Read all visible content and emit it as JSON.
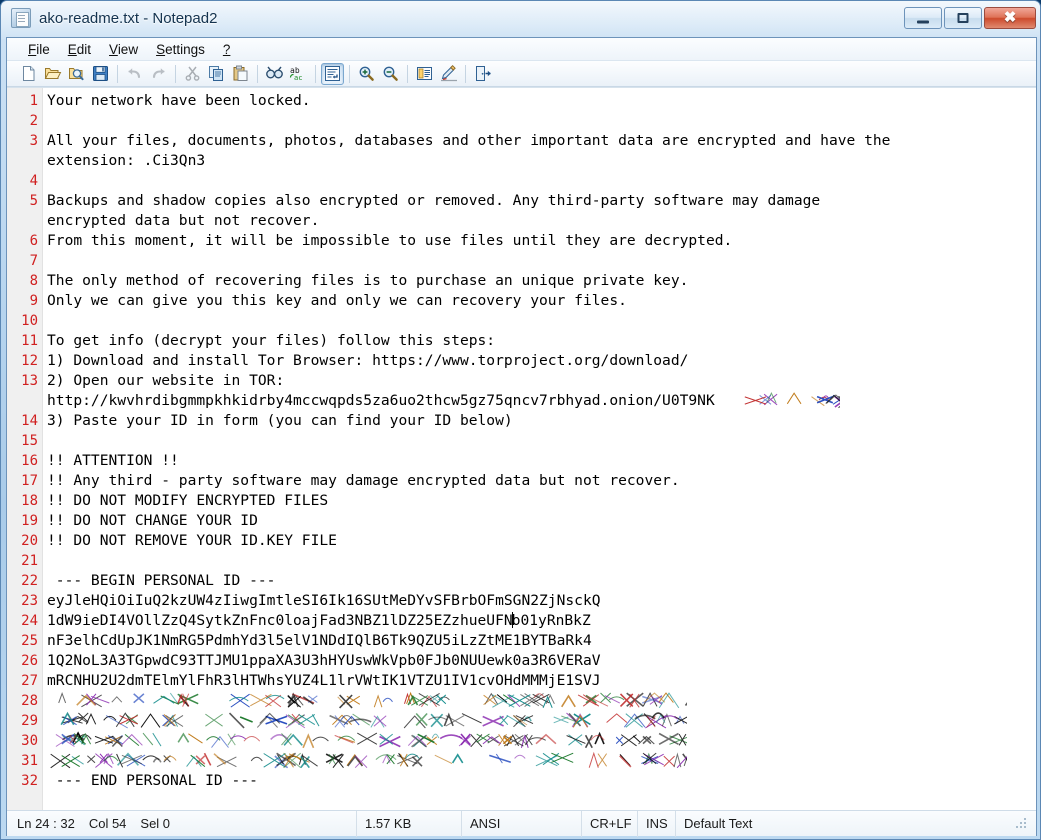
{
  "window": {
    "title": "ako-readme.txt - Notepad2",
    "icon": "notepad-document-icon",
    "buttons": {
      "minimize": "Minimize",
      "maximize": "Maximize",
      "close": "Close"
    }
  },
  "menubar": {
    "items": [
      {
        "label": "File",
        "mnemonic": "F"
      },
      {
        "label": "Edit",
        "mnemonic": "E"
      },
      {
        "label": "View",
        "mnemonic": "V"
      },
      {
        "label": "Settings",
        "mnemonic": "S"
      },
      {
        "label": "?",
        "mnemonic": "?"
      }
    ]
  },
  "toolbar": {
    "buttons": [
      {
        "name": "new-file-icon",
        "title": "New"
      },
      {
        "name": "open-file-icon",
        "title": "Open"
      },
      {
        "name": "file-browser-icon",
        "title": "Browse"
      },
      {
        "name": "save-file-icon",
        "title": "Save"
      },
      {
        "name": "undo-icon",
        "title": "Undo",
        "disabled": true
      },
      {
        "name": "redo-icon",
        "title": "Redo",
        "disabled": true
      },
      {
        "name": "cut-icon",
        "title": "Cut",
        "disabled": true
      },
      {
        "name": "copy-icon",
        "title": "Copy"
      },
      {
        "name": "paste-icon",
        "title": "Paste"
      },
      {
        "name": "find-icon",
        "title": "Find"
      },
      {
        "name": "replace-icon",
        "title": "Replace"
      },
      {
        "name": "word-wrap-icon",
        "title": "Word Wrap",
        "pressed": true
      },
      {
        "name": "zoom-in-icon",
        "title": "Zoom In"
      },
      {
        "name": "zoom-out-icon",
        "title": "Zoom Out"
      },
      {
        "name": "scheme-icon",
        "title": "Scheme"
      },
      {
        "name": "scheme-options-icon",
        "title": "Scheme Options"
      },
      {
        "name": "exit-icon",
        "title": "Exit"
      }
    ]
  },
  "editor": {
    "lines": [
      {
        "n": "1",
        "text": "Your network have been locked."
      },
      {
        "n": "2",
        "text": ""
      },
      {
        "n": "3",
        "text": "All your files, documents, photos, databases and other important data are encrypted and have the"
      },
      {
        "n": "",
        "text": "extension: .Ci3Qn3"
      },
      {
        "n": "4",
        "text": ""
      },
      {
        "n": "5",
        "text": "Backups and shadow copies also encrypted or removed. Any third-party software may damage"
      },
      {
        "n": "",
        "text": "encrypted data but not recover."
      },
      {
        "n": "6",
        "text": "From this moment, it will be impossible to use files until they are decrypted."
      },
      {
        "n": "7",
        "text": ""
      },
      {
        "n": "8",
        "text": "The only method of recovering files is to purchase an unique private key."
      },
      {
        "n": "9",
        "text": "Only we can give you this key and only we can recovery your files."
      },
      {
        "n": "10",
        "text": ""
      },
      {
        "n": "11",
        "text": "To get info (decrypt your files) follow this steps:"
      },
      {
        "n": "12",
        "text": "1) Download and install Tor Browser: https://www.torproject.org/download/"
      },
      {
        "n": "13",
        "text": "2) Open our website in TOR:"
      },
      {
        "n": "",
        "text": "http://kwvhrdibgmmpkhkidrby4mccwqpds5za6uo2thcw5gz75qncv7rbhyad.onion/U0T9NK",
        "redacted_tail": true
      },
      {
        "n": "14",
        "text": "3) Paste your ID in form (you can find your ID below)"
      },
      {
        "n": "15",
        "text": ""
      },
      {
        "n": "16",
        "text": "!! ATTENTION !!"
      },
      {
        "n": "17",
        "text": "!! Any third - party software may damage encrypted data but not recover."
      },
      {
        "n": "18",
        "text": "!! DO NOT MODIFY ENCRYPTED FILES"
      },
      {
        "n": "19",
        "text": "!! DO NOT CHANGE YOUR ID"
      },
      {
        "n": "20",
        "text": "!! DO NOT REMOVE YOUR ID.KEY FILE"
      },
      {
        "n": "21",
        "text": ""
      },
      {
        "n": "22",
        "text": " --- BEGIN PERSONAL ID ---"
      },
      {
        "n": "23",
        "text": "eyJleHQiOiIuQ2kzUW4zIiwgImtleSI6Ik16SUtMeDYvSFBrbOFmSGN2ZjNsckQ"
      },
      {
        "n": "24",
        "text": "1dW9ieDI4VOllZzQ4SytkZnFnc0loajFad3NBZ1lDZ25EZzhueUFN",
        "caret_after": true,
        "text_after_caret": "b01yRnBkZ"
      },
      {
        "n": "25",
        "text": "nF3elhCdUpJK1NmRG5PdmhYd3l5elV1NDdIQlB6Tk9QZU5iLzZtME1BYTBaRk4"
      },
      {
        "n": "26",
        "text": "1Q2NoL3A3TGpwdC93TTJMU1ppaXA3U3hHYUswWkVpb0FJb0NUUewk0a3R6VERaV"
      },
      {
        "n": "27",
        "text": "mRCNHU2U2dmTElmYlFhR3lHTWhsYUZ4L1lrVWtIK1VTZU1IV1cvOHdMMMjE1SVJ"
      },
      {
        "n": "28",
        "text": "",
        "fully_redacted": true
      },
      {
        "n": "29",
        "text": "",
        "fully_redacted": true
      },
      {
        "n": "30",
        "text": "",
        "fully_redacted": true
      },
      {
        "n": "31",
        "text": "",
        "fully_redacted": true
      },
      {
        "n": "32",
        "text": " --- END PERSONAL ID ---"
      }
    ]
  },
  "statusbar": {
    "position": {
      "line_label": "Ln 24 : 32",
      "col_label": "Col 54",
      "sel_label": "Sel 0"
    },
    "file_size": "1.57 KB",
    "encoding": "ANSI",
    "line_endings": "CR+LF",
    "insert_mode": "INS",
    "scheme": "Default Text"
  },
  "colors": {
    "line_number": "#d02020",
    "editor_bg": "#ffffff",
    "gutter_bg": "#f0f0f0",
    "frame_blue": "#a9cbe9",
    "close_red": "#cd4a2c"
  }
}
